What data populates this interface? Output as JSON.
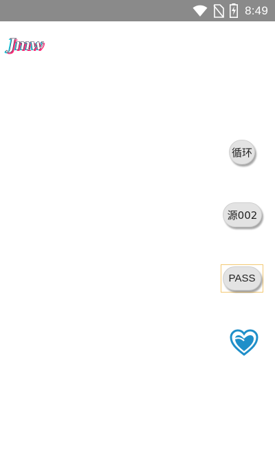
{
  "status_bar": {
    "time": "8:49",
    "icons": [
      "wifi-icon",
      "no-sim-icon",
      "battery-charging-icon"
    ],
    "background": "#8a8a8a"
  },
  "logo": {
    "text": "Jmw"
  },
  "buttons": {
    "loop_label": "循环",
    "source_label": "源002",
    "pass_label": "PASS"
  },
  "favorite": {
    "icon": "heart-icon",
    "color": "#1f8fc9"
  }
}
